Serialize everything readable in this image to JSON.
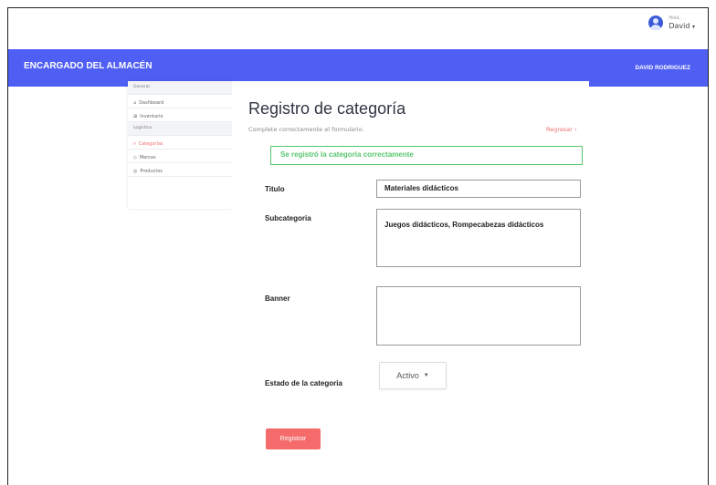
{
  "user": {
    "greeting": "Hola,",
    "name": "David"
  },
  "header": {
    "brand": "ENCARGADO DEL ALMACÉN",
    "user_label": "DAVID RODRIGUEZ"
  },
  "sidebar": {
    "section_general": "General",
    "items_general": [
      {
        "label": "Dashboard",
        "icon": "home-icon"
      },
      {
        "label": "Inventario",
        "icon": "grid-icon"
      }
    ],
    "section_logistica": "Logística",
    "items_logistica": [
      {
        "label": "Categorías",
        "icon": "bookmark-icon",
        "active": true
      },
      {
        "label": "Marcas",
        "icon": "tag-icon"
      },
      {
        "label": "Productos",
        "icon": "box-icon"
      }
    ]
  },
  "main": {
    "title": "Registro de categoría",
    "subtitle": "Complete correctamente el formulario.",
    "back": "Regresar",
    "alert": "Se registró la categoría correctamente",
    "labels": {
      "titulo": "Titulo",
      "subcategoria": "Subcategoria",
      "banner": "Banner",
      "estado": "Estado  de la categoria"
    },
    "values": {
      "titulo": "Materiales didácticos",
      "subcategoria": "Juegos didácticos, Rompecabezas didácticos",
      "banner": ""
    },
    "estado_selected": "Activo",
    "submit": "Registrar"
  },
  "colors": {
    "band": "#4f5ef3",
    "accent": "#f56b6b",
    "success": "#57c76e"
  }
}
